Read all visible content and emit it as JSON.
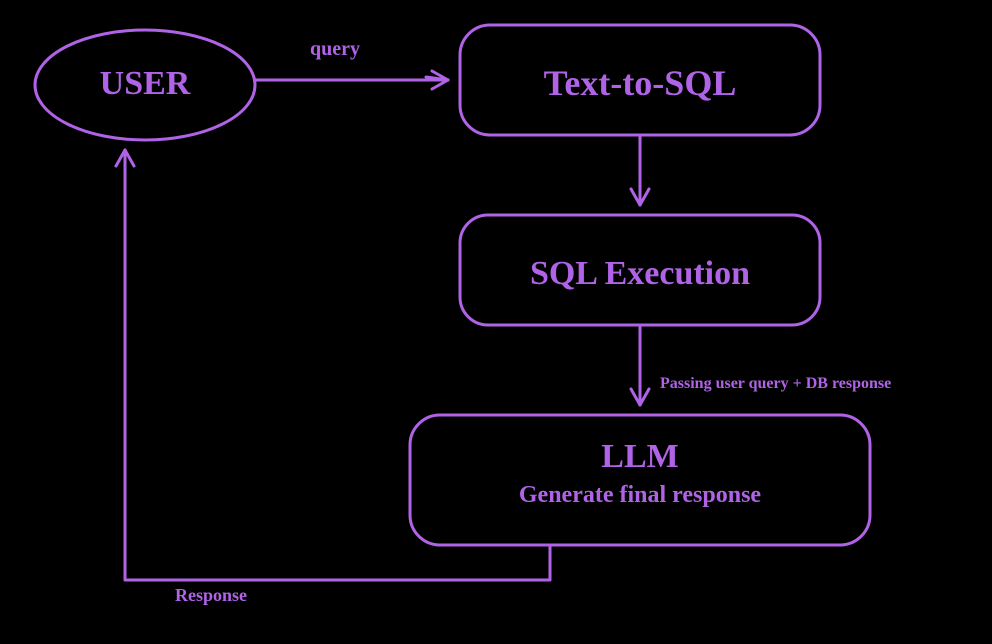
{
  "nodes": {
    "user": {
      "label": "USER"
    },
    "text_to_sql": {
      "label": "Text-to-SQL"
    },
    "sql_execution": {
      "label": "SQL Execution"
    },
    "llm": {
      "title": "LLM",
      "subtitle": "Generate final response"
    }
  },
  "edges": {
    "user_to_t2s": {
      "label": "query"
    },
    "sqlex_to_llm": {
      "label": "Passing user query + DB response"
    },
    "llm_to_user": {
      "label": "Response"
    }
  },
  "colors": {
    "stroke": "#b063e6",
    "bg": "#000000"
  }
}
